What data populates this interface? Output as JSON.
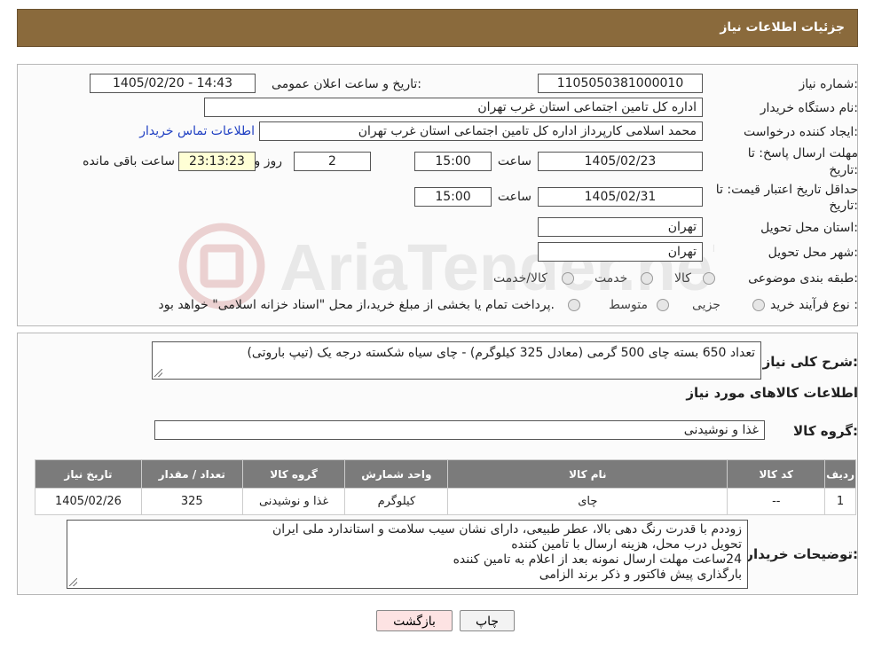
{
  "header": {
    "title": "جزئیات اطلاعات نیاز"
  },
  "watermark_text": "AriaTender.neT",
  "form": {
    "need_number_label": "شماره نیاز:",
    "need_number": "1105050381000010",
    "announce_label": "تاریخ و ساعت اعلان عمومی:",
    "announce_value": "1405/02/20 - 14:43",
    "buyer_org_label": "نام دستگاه خریدار:",
    "buyer_org": "اداره کل تامین اجتماعی استان غرب تهران",
    "creator_label": "ایجاد کننده درخواست:",
    "creator": "محمد اسلامی کارپرداز اداره کل تامین اجتماعی استان غرب تهران",
    "contact_link": "اطلاعات تماس خریدار",
    "reply_deadline_label_1": "مهلت ارسال پاسخ: تا",
    "reply_deadline_label_2": "تاریخ:",
    "reply_date": "1405/02/23",
    "time_label": "ساعت",
    "reply_time": "15:00",
    "days_value": "2",
    "days_label": "روز و",
    "remaining_time": "23:13:23",
    "remaining_label": "ساعت باقی مانده",
    "validity_label_1": "حداقل تاریخ اعتبار قیمت: تا",
    "validity_label_2": "تاریخ:",
    "validity_date": "1405/02/31",
    "validity_time_label": "ساعت",
    "validity_time": "15:00",
    "province_label": "استان محل تحویل:",
    "province": "تهران",
    "city_label": "شهر محل تحویل:",
    "city": "تهران",
    "category_label": "طبقه بندی موضوعی:",
    "category_options": [
      "کالا",
      "خدمت",
      "کالا/خدمت"
    ],
    "process_label": "نوع فرآیند خرید :",
    "process_options": [
      "جزیی",
      "متوسط"
    ],
    "process_note": "پرداخت تمام یا بخشی از مبلغ خرید،از محل \"اسناد خزانه اسلامی\" خواهد بود."
  },
  "details": {
    "summary_label": "شرح کلی نیاز:",
    "summary": "تعداد 650 بسته چای 500 گرمی (معادل 325 کیلوگرم) - چای سیاه شکسته درجه یک (تیپ باروتی)",
    "goods_info_title": "اطلاعات کالاهای مورد نیاز",
    "goods_group_label": "گروه کالا:",
    "goods_group": "غذا و نوشیدنی",
    "table": {
      "headers": [
        "ردیف",
        "کد کالا",
        "نام کالا",
        "واحد شمارش",
        "گروه کالا",
        "تعداد / مقدار",
        "تاریخ نیاز"
      ],
      "rows": [
        [
          "1",
          "--",
          "چای",
          "کیلوگرم",
          "غذا و نوشیدنی",
          "325",
          "1405/02/26"
        ]
      ]
    },
    "buyer_notes_label": "توضیحات خریدار:",
    "buyer_notes": [
      "زوددم با قدرت رنگ دهی بالا، عطر طبیعی، دارای نشان سیب سلامت و استاندارد ملی ایران",
      "تحویل درب محل، هزینه ارسال با تامین کننده",
      "24ساعت مهلت ارسال نمونه بعد از اعلام به تامین کننده",
      "بارگذاری پیش فاکتور و ذکر برند الزامی"
    ]
  },
  "buttons": {
    "print": "چاپ",
    "back": "بازگشت"
  },
  "colors": {
    "header_bg": "#8a6a3c",
    "table_header_bg": "#7b7b7b",
    "highlight_bg": "#ffffd5",
    "link": "#1f3fc2",
    "back_button_bg": "#fde3e3"
  }
}
